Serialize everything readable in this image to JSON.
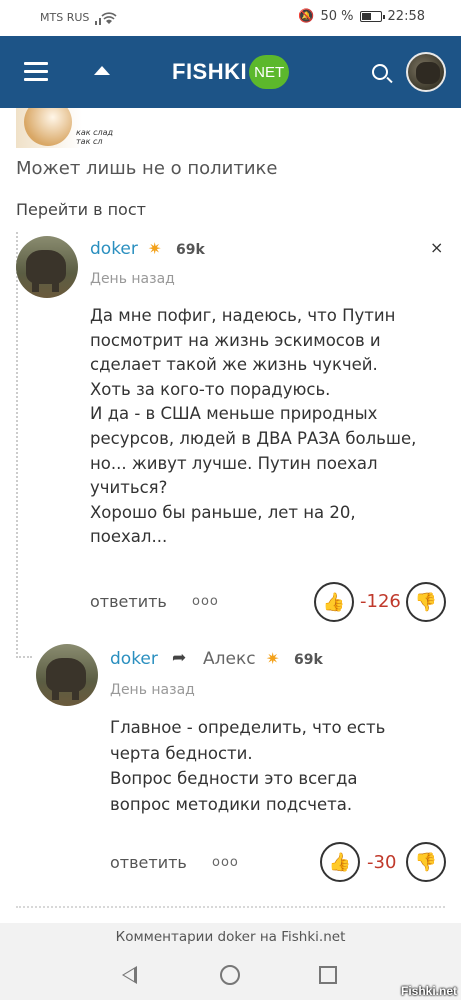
{
  "status_bar": {
    "carrier": "MTS RUS",
    "battery": "50 %",
    "battery_level": 0.5,
    "time": "22:58"
  },
  "header": {
    "logo_text": "FISHKI",
    "logo_badge": "NET",
    "brand_color": "#1d5487",
    "badge_color": "#5cb82c"
  },
  "post": {
    "thumb_caption": "как слад так сл",
    "subtitle": "Может лишь не о политике",
    "go_to_post": "Перейти в пост"
  },
  "comments": [
    {
      "user": "doker",
      "rating": "69k",
      "time": "День назад",
      "text": [
        "Да мне пофиг, надеюсь, что Путин",
        "посмотрит на жизнь эскимосов и",
        "сделает такой же жизнь чукчей.",
        "Хоть за кого-то порадуюсь.",
        "И да - в США меньше природных",
        "ресурсов, людей в ДВА РАЗА больше,",
        "но... живут лучше. Путин поехал",
        "учиться?",
        "Хорошо бы раньше, лет на 20,",
        "поехал..."
      ],
      "reply_label": "ответить",
      "more": "ооо",
      "score": "-126",
      "close": "×"
    },
    {
      "user": "doker",
      "reply_to": "Алекс",
      "rating": "69k",
      "time": "День назад",
      "text": [
        "Главное - определить, что есть",
        "черта бедности.",
        "Вопрос бедности это всегда",
        "вопрос методики подсчета."
      ],
      "reply_label": "ответить",
      "more": "ооо",
      "score": "-30"
    }
  ],
  "footer": {
    "text": "Комментарии doker на Fishki.net"
  },
  "watermark": "Fishki.net"
}
